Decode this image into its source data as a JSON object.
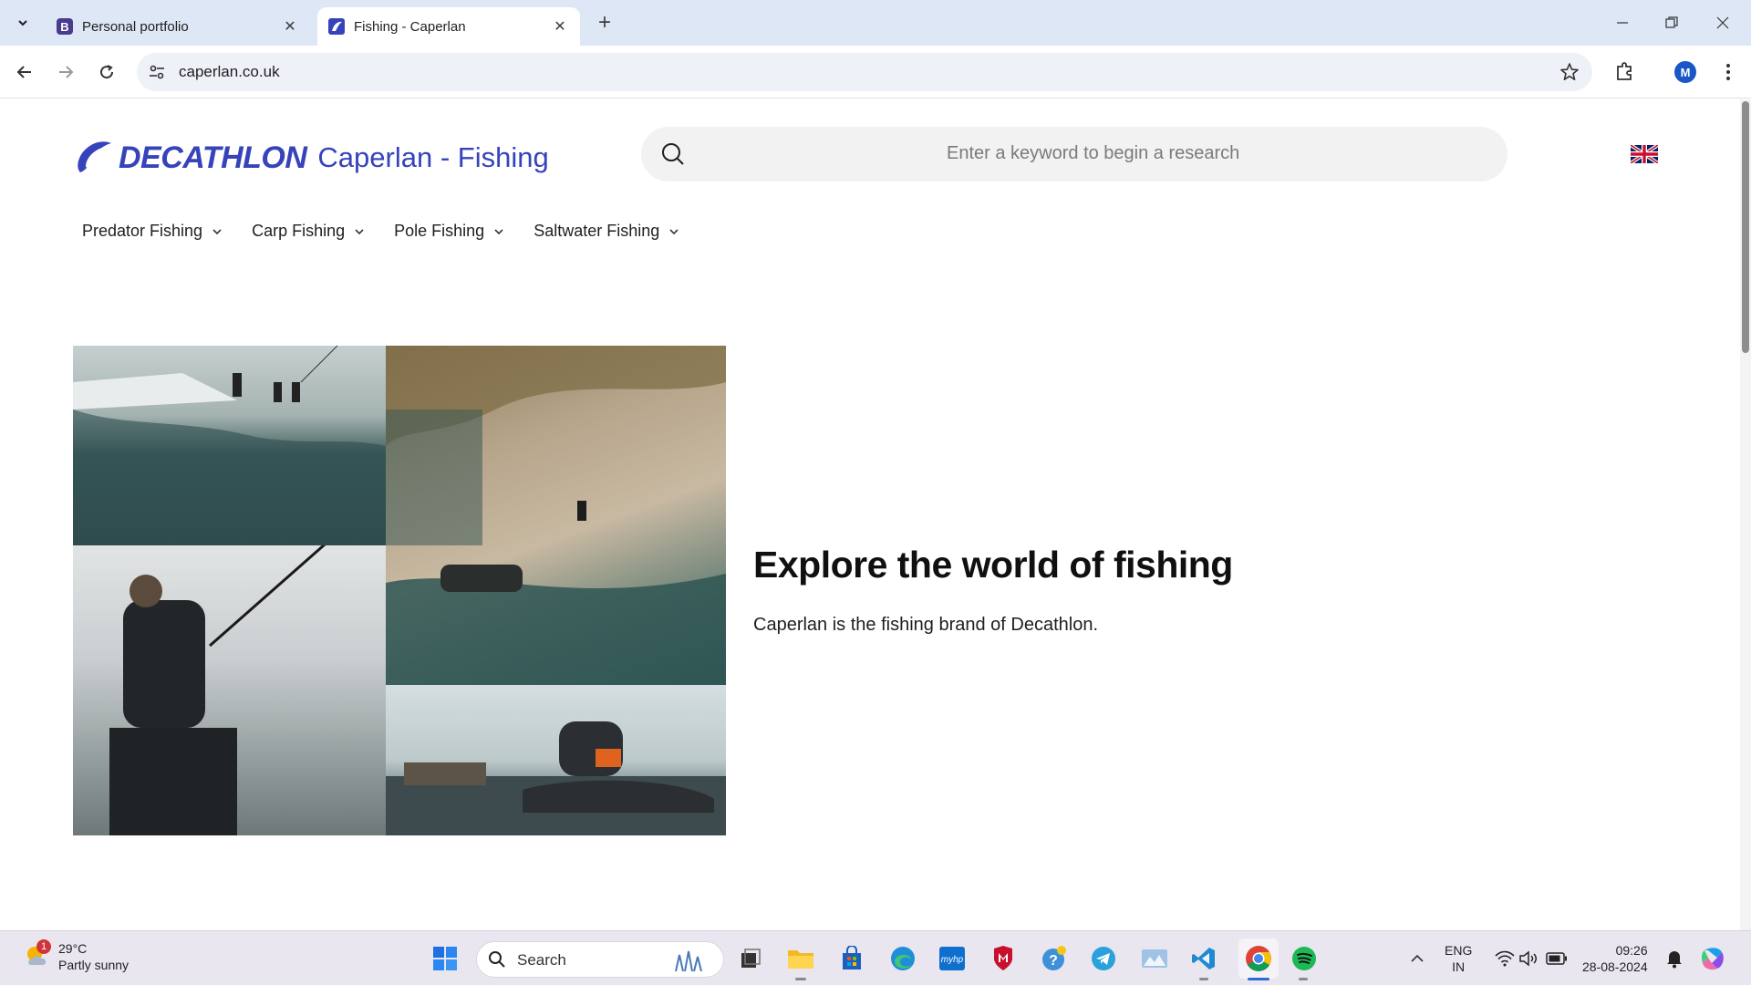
{
  "browser": {
    "tabs": [
      {
        "title": "Personal portfolio",
        "favicon": "bootstrap-B-icon",
        "active": false
      },
      {
        "title": "Fishing - Caperlan",
        "favicon": "decathlon-swirl-icon",
        "active": true
      }
    ],
    "url": "caperlan.co.uk",
    "profile_initial": "M"
  },
  "site": {
    "brand": "DECATHLON",
    "subtitle": "Caperlan - Fishing",
    "search_placeholder": "Enter a keyword to begin a research",
    "language_flag": "uk-flag-icon",
    "nav": [
      {
        "label": "Predator Fishing"
      },
      {
        "label": "Carp Fishing"
      },
      {
        "label": "Pole Fishing"
      },
      {
        "label": "Saltwater Fishing"
      }
    ],
    "hero": {
      "title": "Explore the world of fishing",
      "subtitle": "Caperlan is the fishing brand of Decathlon."
    },
    "brand_color": "#3643ba"
  },
  "taskbar": {
    "weather": {
      "temp": "29°C",
      "condition": "Partly sunny",
      "badge": "1"
    },
    "search_label": "Search",
    "lang_line1": "ENG",
    "lang_line2": "IN",
    "time": "09:26",
    "date": "28-08-2024"
  }
}
